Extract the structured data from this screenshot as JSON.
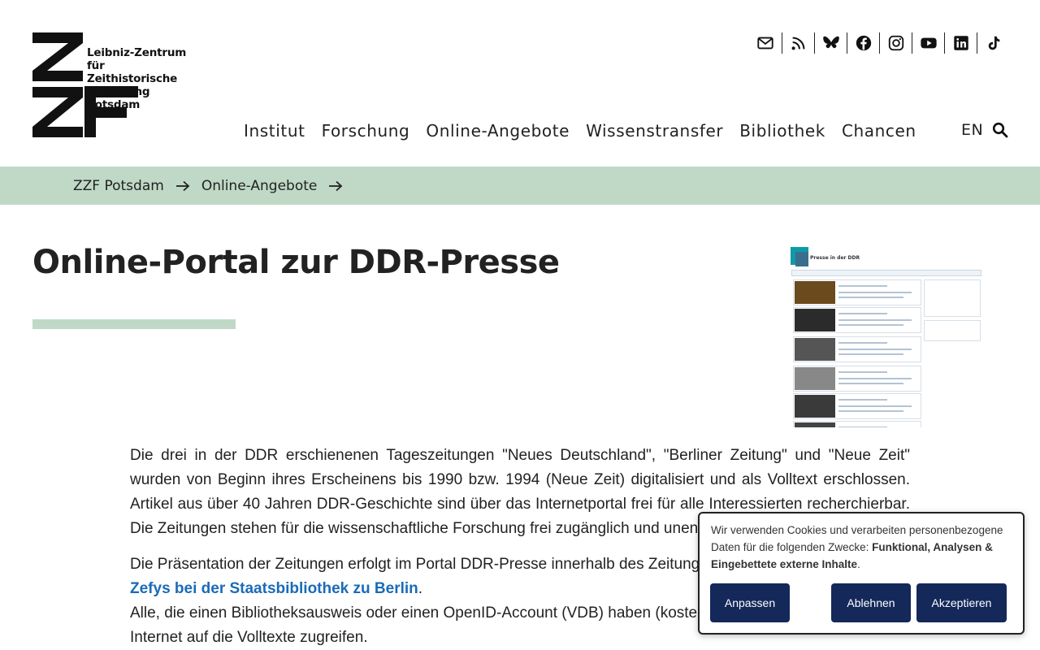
{
  "logo": {
    "line1": "Leibniz-Zentrum für",
    "line2": "Zeithistorische",
    "line3": "Forschung Potsdam"
  },
  "social": [
    "mail-icon",
    "rss-icon",
    "bluesky-icon",
    "facebook-icon",
    "instagram-icon",
    "youtube-icon",
    "linkedin-icon",
    "tiktok-icon"
  ],
  "nav": {
    "items": [
      "Institut",
      "Forschung",
      "Online-Angebote",
      "Wissenstransfer",
      "Bibliothek",
      "Chancen"
    ],
    "lang": "EN"
  },
  "breadcrumb": [
    "ZZF Potsdam",
    "Online-Angebote"
  ],
  "page": {
    "title": "Online-Portal zur DDR-Presse"
  },
  "thumbnail": {
    "heading": "Presse in der DDR"
  },
  "content": {
    "p1": "Die drei in der DDR erschienenen Tageszeitungen \"Neues Deutschland\", \"Berliner Zeitung\" und \"Neue Zeit\" wurden von Beginn ihres Erscheinens bis 1990 bzw. 1994 (Neue Zeit) digitalisiert und als Volltext erschlossen. Artikel aus über 40 Jahren DDR-Geschichte sind über das Internetportal frei für alle Interessierten recherchierbar. Die Zeitungen stehen für die wissenschaftliche Forschung frei zugänglich und unentgeltlich zur Verfügung.",
    "p2_before": "Die Präsentation der Zeitungen erfolgt im Portal DDR-Presse innerhalb des Zeitungsportals",
    "p2_link": "Zefys bei der Staatsbibliothek zu Berlin",
    "p2_after": ".",
    "p3": "Alle, die einen Bibliotheksausweis oder einen OpenID-Account (VDB) haben (kostenlos), können über das Internet auf die Volltexte zugreifen."
  },
  "cookie": {
    "text_before": "Wir verwenden Cookies und verarbeiten personenbezogene Daten für die folgenden Zwecke: ",
    "text_bold": "Funktional, Analysen & Eingebettete externe Inhalte",
    "text_after": ".",
    "btn_customize": "Anpassen",
    "btn_reject": "Ablehnen",
    "btn_accept": "Akzeptieren"
  }
}
